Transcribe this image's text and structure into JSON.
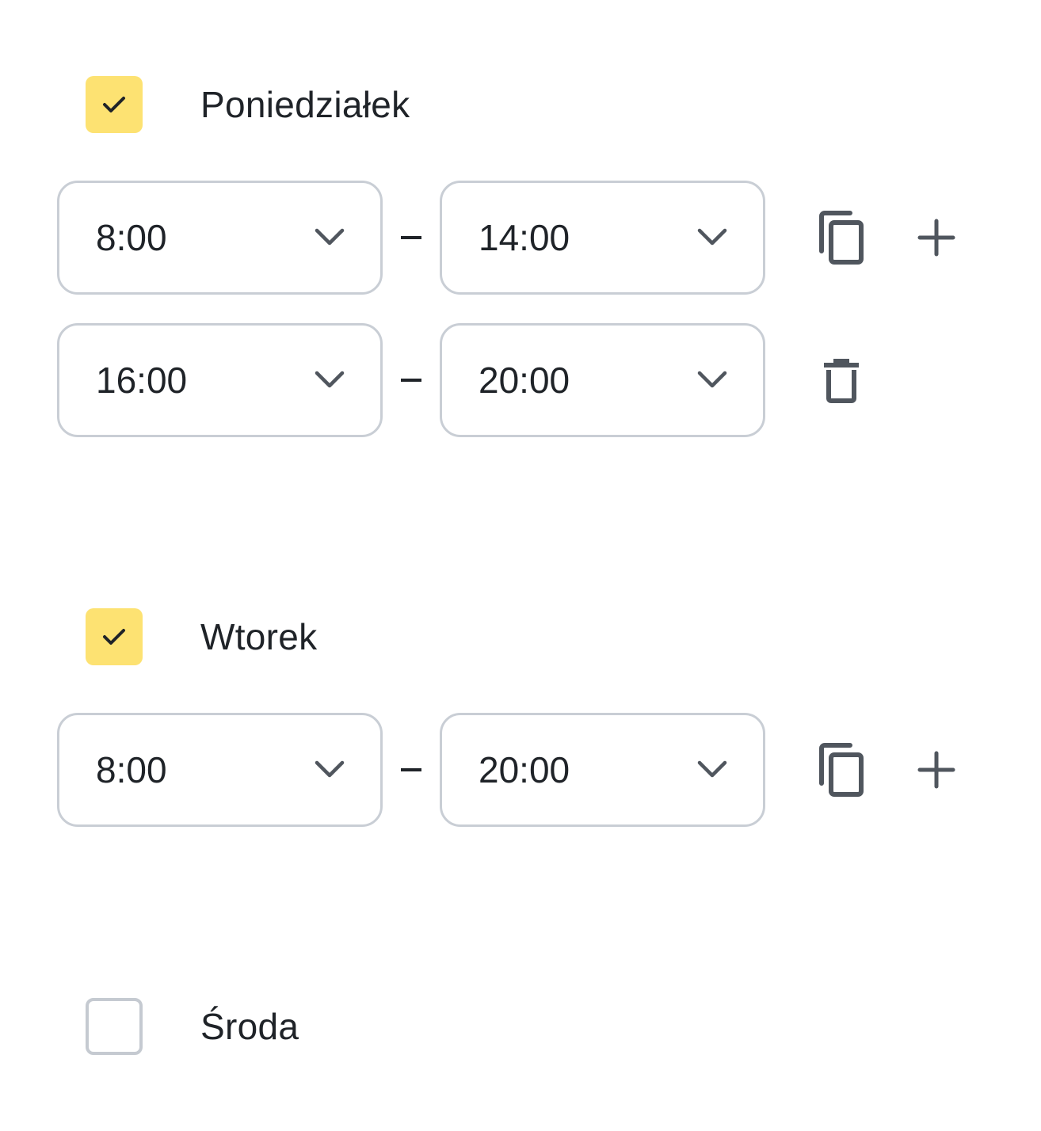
{
  "days": [
    {
      "label": "Poniedziałek",
      "checked": true,
      "slots": [
        {
          "start": "8:00",
          "separator": "–",
          "end": "14:00",
          "actions": [
            "copy-icon",
            "plus-icon"
          ]
        },
        {
          "start": "16:00",
          "separator": "–",
          "end": "20:00",
          "actions": [
            "trash-icon"
          ]
        }
      ]
    },
    {
      "label": "Wtorek",
      "checked": true,
      "slots": [
        {
          "start": "8:00",
          "separator": "–",
          "end": "20:00",
          "actions": [
            "copy-icon",
            "plus-icon"
          ]
        }
      ]
    },
    {
      "label": "Środa",
      "checked": false,
      "slots": []
    }
  ],
  "colors": {
    "checkbox_checked": "#fde272",
    "checkbox_unchecked_border": "#c5cad1",
    "field_border": "#c9ced5",
    "icon": "#50565e",
    "text": "#1f2328"
  }
}
